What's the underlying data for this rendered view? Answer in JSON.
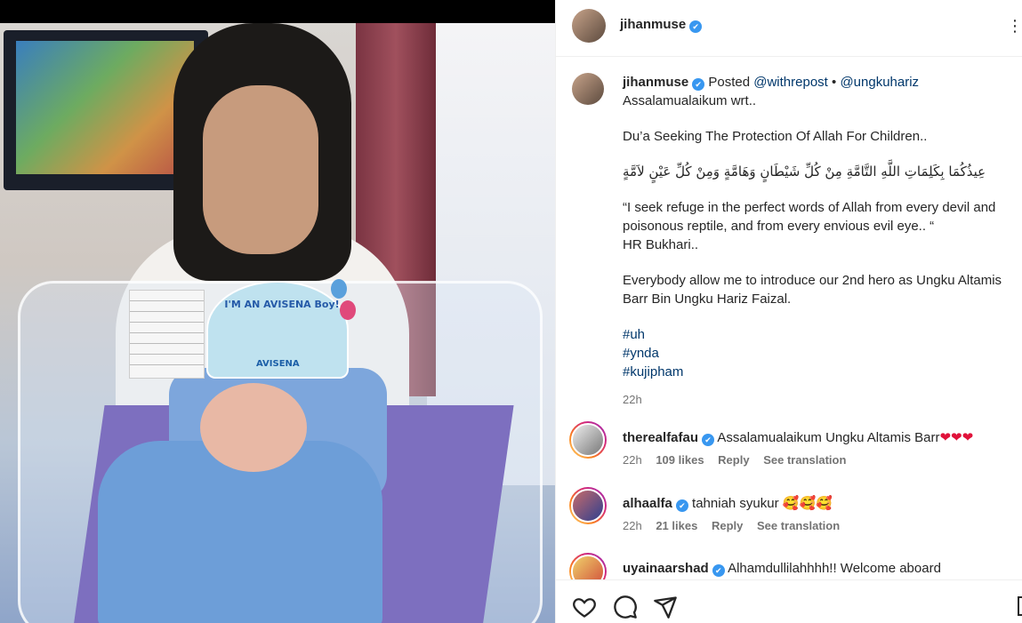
{
  "post": {
    "author": "jihanmuse",
    "posted_prefix": "Posted",
    "repost_via": "@withrepost",
    "bullet": "•",
    "original_author": "@ungkuhariz",
    "caption": {
      "greeting": "Assalamualaikum wrt..",
      "title": "Du’a Seeking The Protection Of Allah For Children..",
      "arabic": "عِيذُكُمَا بِكَلِمَاتِ اللَّهِ التَّامَّةِ مِنْ كُلِّ شَيْطَانٍ وَهَامَّةٍ وَمِنْ كُلِّ عَيْنٍ لاَمَّةٍ",
      "translation_1": "“I seek refuge in the perfect words of Allah from every devil and poisonous reptile, and from every envious evil eye.. “",
      "source": "HR Bukhari..",
      "intro": "Everybody allow me to introduce our 2nd hero as Ungku Altamis Barr Bin Ungku Hariz Faizal.",
      "hashtags": [
        "#uh",
        "#ynda",
        "#kujipham"
      ]
    },
    "time": "22h"
  },
  "photo": {
    "card_text": "I'M AN AVISENA Boy!",
    "card_brand": "AVISENA"
  },
  "comments": [
    {
      "user": "therealfafau",
      "text": "Assalamualaikum Ungku Altamis Barr",
      "emoji": "❤❤❤",
      "time": "22h",
      "likes": "109 likes",
      "reply": "Reply",
      "translate": "See translation"
    },
    {
      "user": "alhaalfa",
      "text": "tahniah syukur",
      "emoji": "🥰🥰🥰",
      "time": "22h",
      "likes": "21 likes",
      "reply": "Reply",
      "translate": "See translation"
    },
    {
      "user": "uyainaarshad",
      "text": "Alhamdullilahhhh!! Welcome aboard",
      "emoji": "",
      "time": "",
      "likes": "",
      "reply": "",
      "translate": ""
    }
  ],
  "icons": {
    "verified": "✔",
    "more": "⋮",
    "like": "heart-icon",
    "comment": "comment-icon",
    "share": "share-icon",
    "save": "bookmark-icon"
  },
  "colors": {
    "link": "#00376b",
    "verified": "#3897f0",
    "meta": "#737373"
  }
}
